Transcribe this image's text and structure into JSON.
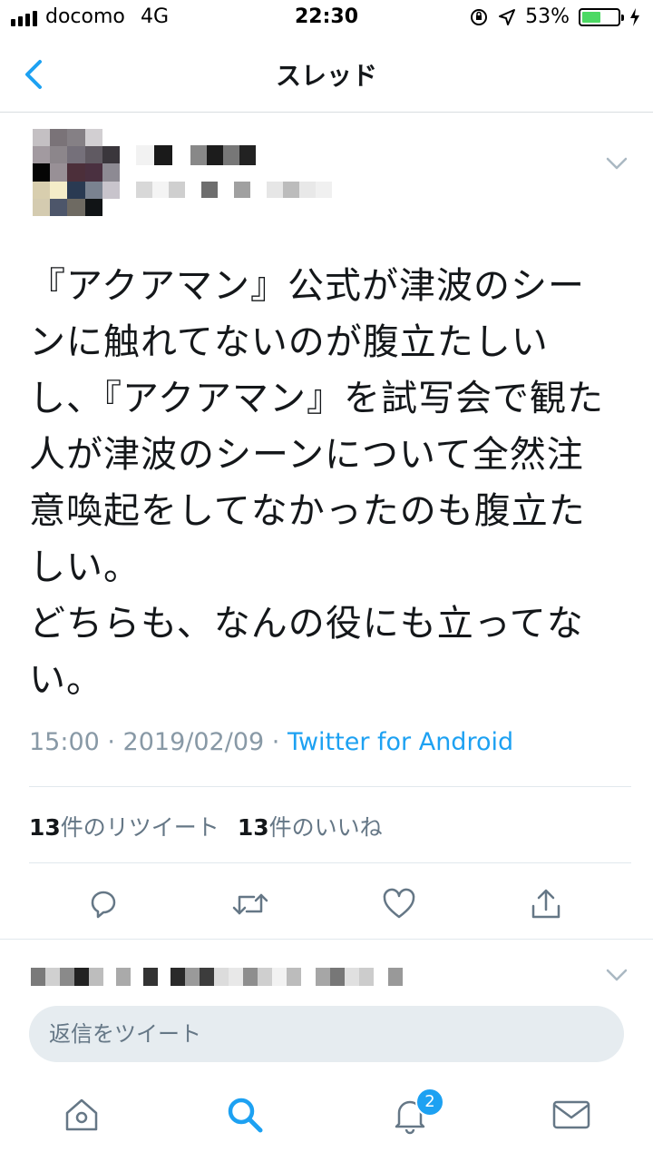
{
  "status_bar": {
    "carrier": "docomo",
    "network": "4G",
    "time": "22:30",
    "battery_percent": "53%",
    "battery_level": 0.53,
    "icons": [
      "signal-icon",
      "rotation-lock-icon",
      "location-icon",
      "battery-icon",
      "charging-icon"
    ]
  },
  "nav": {
    "title": "スレッド",
    "back_icon": "chevron-left-icon"
  },
  "tweet": {
    "text": "『アクアマン』公式が津波のシーンに触れてないのが腹立たしいし、『アクアマン』を試写会で観た人が津波のシーンについて全然注意喚起をしてなかったのも腹立たしい。\nどちらも、なんの役にも立ってない。",
    "timestamp": "15:00 · 2019/02/09 · ",
    "source": "Twitter for Android",
    "retweet_count": "13",
    "retweet_label": "件のリツイート",
    "like_count": "13",
    "like_label": "件のいいね",
    "menu_icon": "chevron-down-icon"
  },
  "actions": [
    "reply-icon",
    "retweet-icon",
    "like-icon",
    "share-icon"
  ],
  "reply_input": {
    "placeholder": "返信をツイート"
  },
  "tab_bar": {
    "tabs": [
      "home-icon",
      "search-icon",
      "notifications-icon",
      "messages-icon"
    ],
    "active": "search-icon",
    "notification_badge": "2"
  },
  "colors": {
    "accent": "#1da1f2",
    "meta_text": "#8899a6",
    "secondary_text": "#657786",
    "input_bg": "#e6ecf0",
    "battery_fill": "#4cd964"
  }
}
